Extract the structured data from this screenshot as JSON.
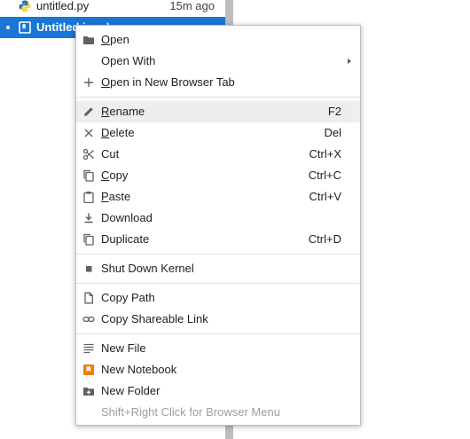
{
  "filebrowser": {
    "files": [
      {
        "name": "untitled.py",
        "modified": "15m ago",
        "icon": "python-icon"
      },
      {
        "name": "Untitled.ipynb",
        "modified": "",
        "icon": "notebook-icon",
        "selected": true
      }
    ]
  },
  "context_menu": {
    "open": {
      "label": "Open",
      "icon": "folder-icon"
    },
    "open_with": {
      "label": "Open With",
      "icon": ""
    },
    "open_new_tab": {
      "label": "Open in New Browser Tab",
      "icon": "plus-icon"
    },
    "rename": {
      "label": "Rename",
      "shortcut": "F2",
      "icon": "pencil-icon"
    },
    "delete": {
      "label": "Delete",
      "shortcut": "Del",
      "icon": "close-icon"
    },
    "cut": {
      "label": "Cut",
      "shortcut": "Ctrl+X",
      "icon": "scissors-icon"
    },
    "copy": {
      "label": "Copy",
      "shortcut": "Ctrl+C",
      "icon": "copy-icon"
    },
    "paste": {
      "label": "Paste",
      "shortcut": "Ctrl+V",
      "icon": "paste-icon"
    },
    "download": {
      "label": "Download",
      "icon": "download-icon"
    },
    "duplicate": {
      "label": "Duplicate",
      "shortcut": "Ctrl+D",
      "icon": "duplicate-icon"
    },
    "shutdown": {
      "label": "Shut Down Kernel",
      "icon": "stop-icon"
    },
    "copy_path": {
      "label": "Copy Path",
      "icon": "file-icon"
    },
    "copy_link": {
      "label": "Copy Shareable Link",
      "icon": "link-icon"
    },
    "new_file": {
      "label": "New File",
      "icon": "text-file-icon"
    },
    "new_notebook": {
      "label": "New Notebook",
      "icon": "notebook-icon"
    },
    "new_folder": {
      "label": "New Folder",
      "icon": "new-folder-icon"
    },
    "hint": {
      "label": "Shift+Right Click for Browser Menu"
    }
  },
  "colors": {
    "selection": "#1976d2",
    "notebook_orange": "#f57c00",
    "python_blue": "#3572A5",
    "python_yellow": "#FFD43B",
    "highlight": "#eeeeee"
  }
}
